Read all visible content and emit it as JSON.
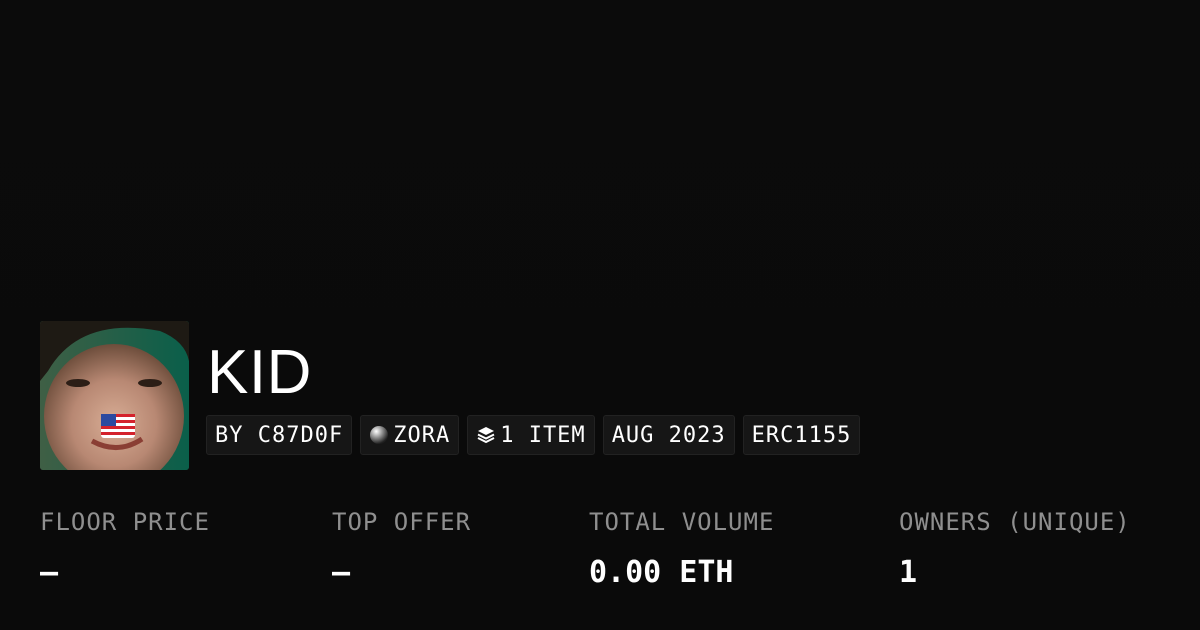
{
  "collection": {
    "title": "KID",
    "avatar_alt": "kid-with-us-flag"
  },
  "tags": {
    "creator": "BY C87D0F",
    "chain": "ZORA",
    "items": "1 ITEM",
    "date": "AUG 2023",
    "standard": "ERC1155"
  },
  "stats": {
    "floor_price": {
      "label": "FLOOR PRICE",
      "value": "–"
    },
    "top_offer": {
      "label": "TOP OFFER",
      "value": "–"
    },
    "total_volume": {
      "label": "TOTAL VOLUME",
      "value": "0.00 ETH"
    },
    "owners": {
      "label": "OWNERS (UNIQUE)",
      "value": "1"
    }
  },
  "colors": {
    "background": "#0b0b0b",
    "tag_background": "#161616",
    "label": "#8f8f8f",
    "text": "#ffffff"
  },
  "icons": {
    "chain": "zora-orb-icon",
    "items": "layers-icon",
    "avatar_badge": "us-flag-icon"
  }
}
